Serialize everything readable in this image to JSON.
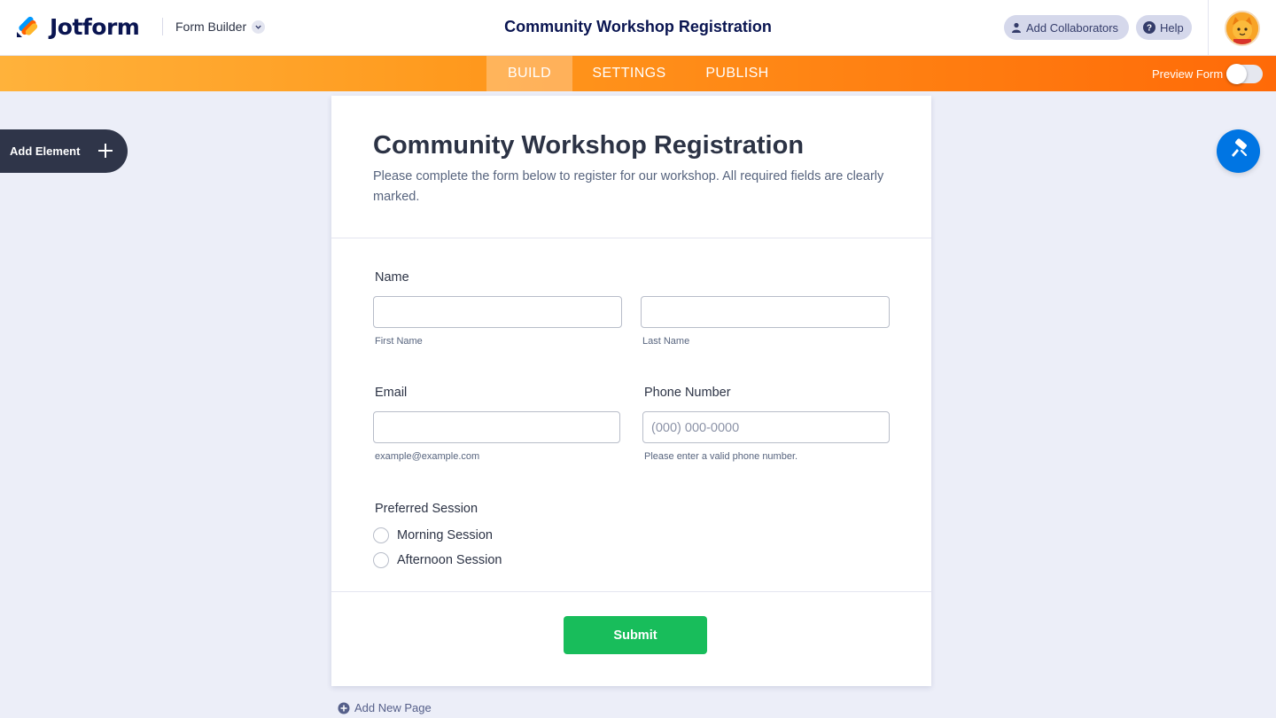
{
  "header": {
    "logo_text": "Jotform",
    "builder_label": "Form Builder",
    "page_title": "Community Workshop Registration",
    "add_collaborators_label": "Add Collaborators",
    "help_label": "Help"
  },
  "nav": {
    "tabs": [
      {
        "label": "BUILD",
        "active": true
      },
      {
        "label": "SETTINGS",
        "active": false
      },
      {
        "label": "PUBLISH",
        "active": false
      }
    ],
    "preview_label": "Preview Form",
    "preview_enabled": false
  },
  "sidebar": {
    "add_element_label": "Add Element"
  },
  "form": {
    "title": "Community Workshop Registration",
    "description": "Please complete the form below to register for our workshop. All required fields are clearly marked.",
    "name_label": "Name",
    "first_name_value": "",
    "last_name_value": "",
    "first_name_sublabel": "First Name",
    "last_name_sublabel": "Last Name",
    "email_label": "Email",
    "email_value": "",
    "email_sublabel": "example@example.com",
    "phone_label": "Phone Number",
    "phone_value": "",
    "phone_placeholder": "(000) 000-0000",
    "phone_sublabel": "Please enter a valid phone number.",
    "session_label": "Preferred Session",
    "session_options": [
      "Morning Session",
      "Afternoon Session"
    ],
    "submit_label": "Submit"
  },
  "footer": {
    "add_page_label": "Add New Page"
  },
  "colors": {
    "navy": "#0a1551",
    "orange_start": "#ffb23b",
    "orange_end": "#ff6a08",
    "submit_green": "#18bd5b",
    "paint_blue": "#0075e3"
  },
  "icons": {
    "logo": "jotform-logo-icon",
    "collaborators": "user-icon",
    "help": "question-icon",
    "paint": "paint-roller-icon",
    "add": "plus-icon"
  }
}
